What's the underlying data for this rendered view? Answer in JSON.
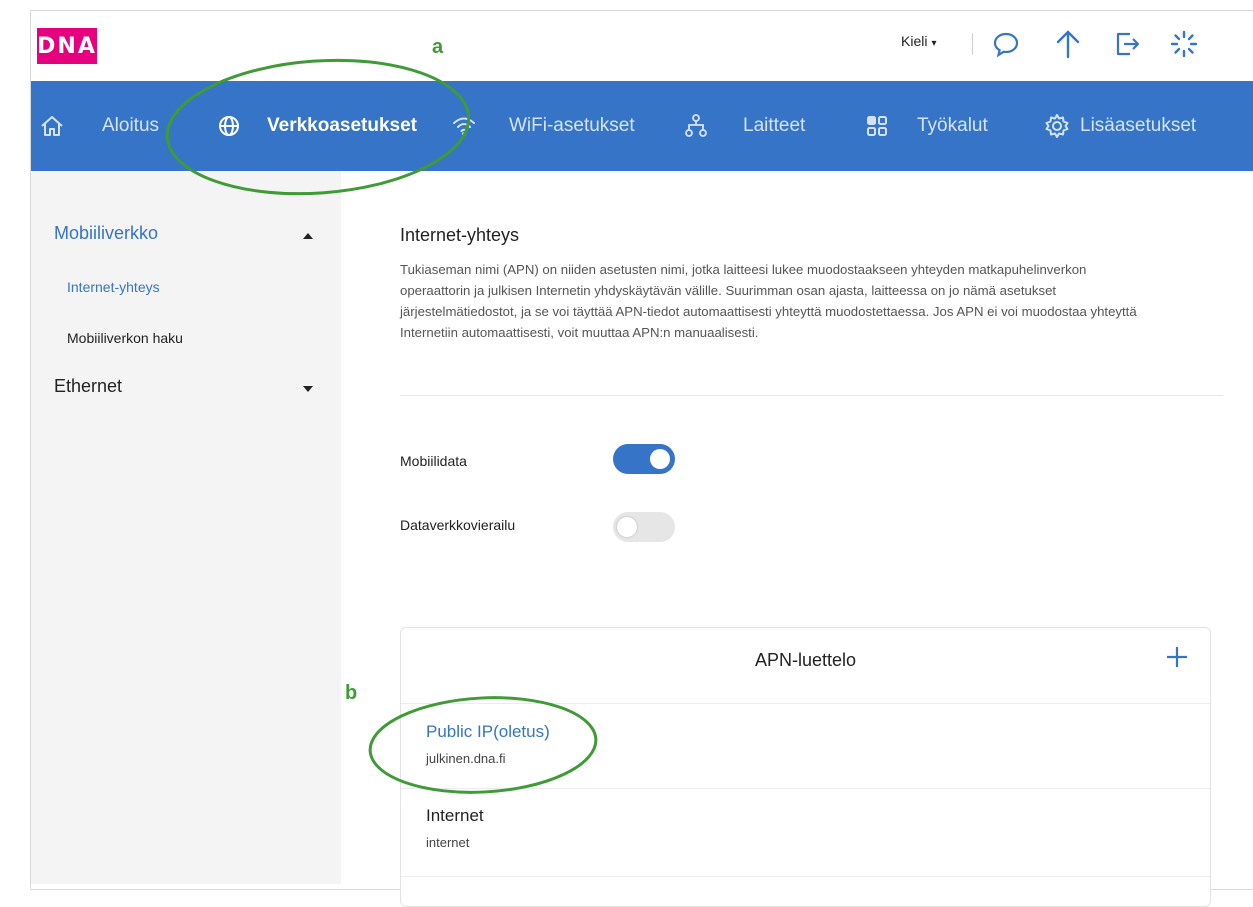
{
  "header": {
    "logo_text": "DNA",
    "language_label": "Kieli",
    "icons": [
      "chat-icon",
      "upload-icon",
      "logout-icon",
      "loading-icon"
    ]
  },
  "nav": {
    "items": [
      {
        "label": "Aloitus",
        "icon": "home-icon"
      },
      {
        "label": "Verkkoasetukset",
        "icon": "globe-icon",
        "active": true
      },
      {
        "label": "WiFi-asetukset",
        "icon": "wifi-icon"
      },
      {
        "label": "Laitteet",
        "icon": "network-devices-icon"
      },
      {
        "label": "Työkalut",
        "icon": "tools-grid-icon"
      },
      {
        "label": "Lisäasetukset",
        "icon": "gear-icon"
      }
    ]
  },
  "sidebar": {
    "groups": [
      {
        "label": "Mobiiliverkko",
        "expanded": true,
        "items": [
          {
            "label": "Internet-yhteys",
            "active": true
          },
          {
            "label": "Mobiiliverkon haku",
            "active": false
          }
        ]
      },
      {
        "label": "Ethernet",
        "expanded": false,
        "items": []
      }
    ]
  },
  "main": {
    "title": "Internet-yhteys",
    "description": "Tukiaseman nimi (APN) on niiden asetusten nimi, jotka laitteesi lukee muodostaakseen yhteyden matkapuhelinverkon operaattorin ja julkisen Internetin yhdyskäytävän välille. Suurimman osan ajasta, laitteessa on jo nämä asetukset järjestelmätiedostot, ja se voi täyttää APN-tiedot automaattisesti yhteyttä muodostettaessa. Jos APN ei voi muodostaa yhteyttä Internetiin automaattisesti, voit muuttaa APN:n manuaalisesti.",
    "toggles": [
      {
        "label": "Mobiilidata",
        "on": true
      },
      {
        "label": "Dataverkkovierailu",
        "on": false
      }
    ],
    "apn_list": {
      "title": "APN-luettelo",
      "add_icon": "plus-icon",
      "entries": [
        {
          "name": "Public IP(oletus)",
          "apn": "julkinen.dna.fi",
          "default": true
        },
        {
          "name": "Internet",
          "apn": "internet",
          "default": false
        }
      ]
    }
  },
  "annotations": {
    "a": "a",
    "b": "b"
  },
  "colors": {
    "brand_pink": "#e5007d",
    "nav_blue": "#3574c7",
    "link_blue": "#3574c7",
    "annotation_green": "#3f9b35"
  }
}
